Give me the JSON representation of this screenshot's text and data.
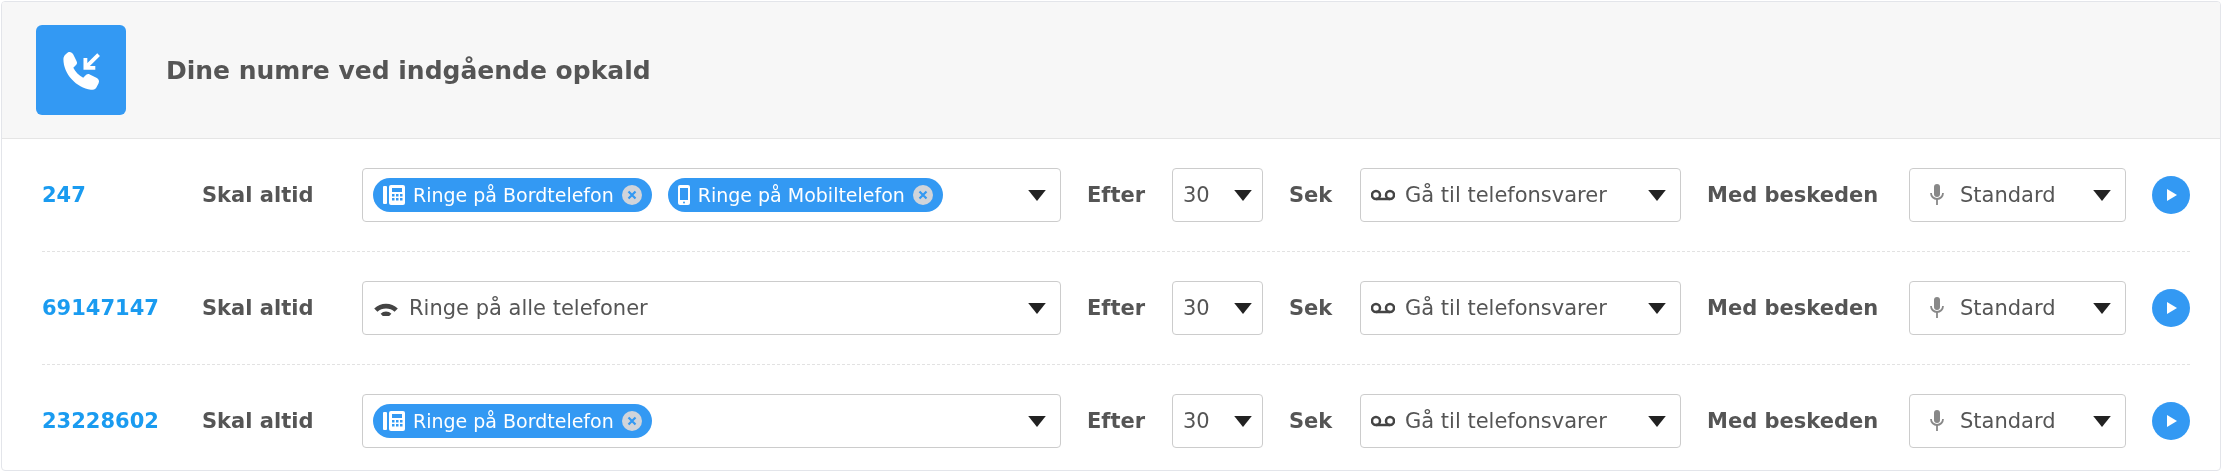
{
  "header": {
    "title": "Dine numre ved indgående opkald"
  },
  "rows": [
    {
      "number": "247",
      "rule": "Skal altid",
      "targets": [
        {
          "kind": "desk",
          "label": "Ringe på Bordtelefon"
        },
        {
          "kind": "mobile",
          "label": "Ringe på Mobiltelefon"
        }
      ],
      "after": "Efter",
      "seconds": "30",
      "unit": "Sek",
      "action": "Gå til telefonsvarer",
      "message_label": "Med beskeden",
      "message": "Standard"
    },
    {
      "number": "69147147",
      "rule": "Skal altid",
      "targets": [
        {
          "kind": "all",
          "label": "Ringe på alle telefoner"
        }
      ],
      "after": "Efter",
      "seconds": "30",
      "unit": "Sek",
      "action": "Gå til telefonsvarer",
      "message_label": "Med beskeden",
      "message": "Standard"
    },
    {
      "number": "23228602",
      "rule": "Skal altid",
      "targets": [
        {
          "kind": "desk",
          "label": "Ringe på Bordtelefon"
        }
      ],
      "after": "Efter",
      "seconds": "30",
      "unit": "Sek",
      "action": "Gå til telefonsvarer",
      "message_label": "Med beskeden",
      "message": "Standard"
    }
  ]
}
